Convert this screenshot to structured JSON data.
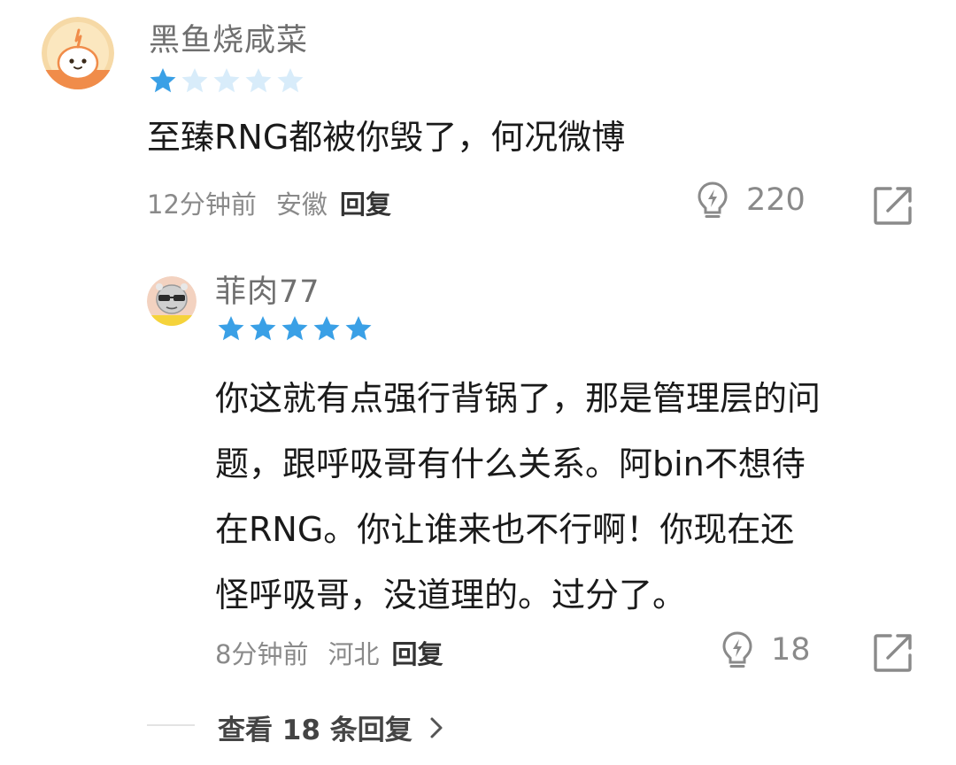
{
  "main_comment": {
    "username": "黑鱼烧咸菜",
    "rating": 1,
    "rating_max": 5,
    "text": "至臻RNG都被你毁了，何况微博",
    "time": "12分钟前",
    "location": "安徽",
    "reply_label": "回复",
    "like_count": "220",
    "avatar_icon": "cartoon-sprout-avatar",
    "star_color": "#3aa0e6",
    "star_empty_color": "#d8ecfa"
  },
  "reply_comment": {
    "username": "菲肉77",
    "rating": 5,
    "rating_max": 5,
    "text_lines": [
      "你这就有点强行背锅了，那是管理层的问",
      "题，跟呼吸哥有什么关系。阿bin不想待",
      "在RNG。你让谁来也不行啊！你现在还",
      "怪呼吸哥，没道理的。过分了。"
    ],
    "time": "8分钟前",
    "location": "河北",
    "reply_label": "回复",
    "like_count": "18",
    "avatar_icon": "sunglasses-cartoon-avatar"
  },
  "view_more": {
    "label": "查看 18 条回复",
    "icon": "chevron-right-icon"
  }
}
